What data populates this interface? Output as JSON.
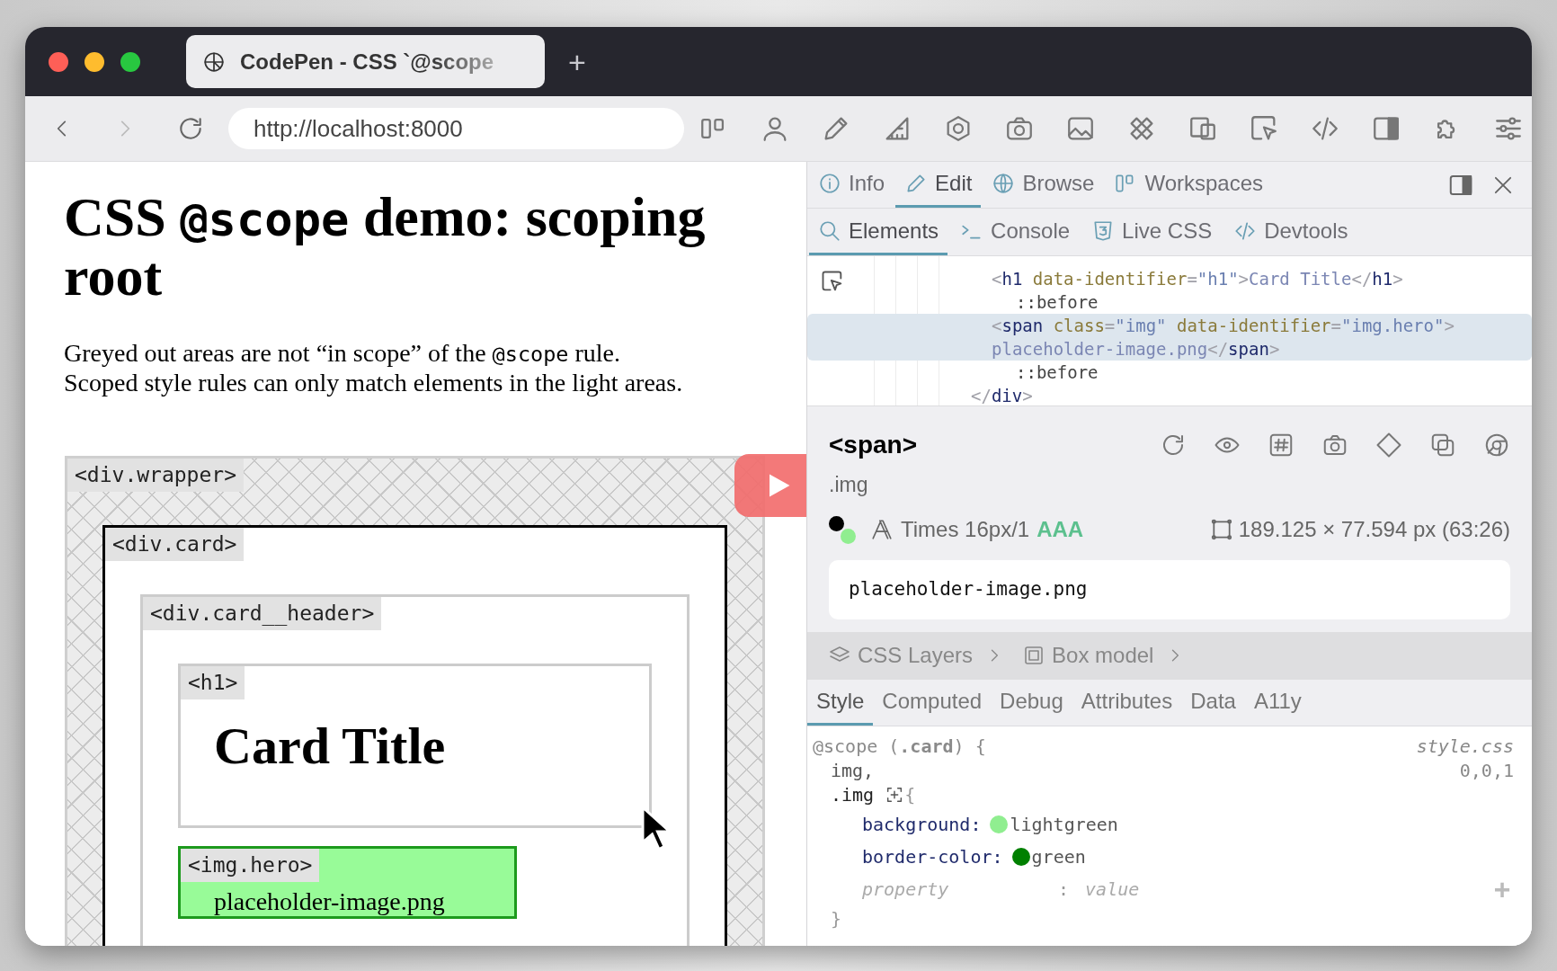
{
  "browser": {
    "tab": {
      "title": "CodePen - CSS `@scope"
    },
    "new_tab": "+",
    "url": "http://localhost:8000"
  },
  "page": {
    "heading": [
      {
        "text": "CSS ",
        "kind": "plain"
      },
      {
        "text": "@scope",
        "kind": "code"
      },
      {
        "text": " demo: scoping root",
        "kind": "plain"
      }
    ],
    "intro": [
      {
        "text": "Greyed out areas are not “in scope” of the ",
        "kind": "plain"
      },
      {
        "text": "@scope",
        "kind": "code"
      },
      {
        "text": " rule. Scoped style rules can only match elements in the light areas.",
        "kind": "plain"
      }
    ],
    "diagram": {
      "label": "<div.wrapper>",
      "kind": "out_of_scope",
      "children": [
        {
          "label": "<div.card>",
          "kind": "scope_root",
          "children": [
            {
              "label": "<div.card__header>",
              "kind": "element",
              "children": [
                {
                  "label": "<h1>",
                  "kind": "element",
                  "content": "Card Title"
                },
                {
                  "label": "<img.hero>",
                  "kind": "matched",
                  "content": "placeholder-image.png"
                }
              ]
            }
          ]
        }
      ]
    }
  },
  "devtools": {
    "top_tabs": [
      {
        "label": "Info",
        "selected": false
      },
      {
        "label": "Edit",
        "selected": true
      },
      {
        "label": "Browse",
        "selected": false
      },
      {
        "label": "Workspaces",
        "selected": false
      }
    ],
    "sub_tabs": [
      {
        "label": "Elements",
        "selected": true
      },
      {
        "label": "Console",
        "selected": false
      },
      {
        "label": "Live CSS",
        "selected": false
      },
      {
        "label": "Devtools",
        "selected": false
      }
    ],
    "dom_tree": {
      "children": [
        {
          "selected": false,
          "tokens": [
            {
              "text": "<",
              "kind": "punct"
            },
            {
              "text": "h1",
              "kind": "tag"
            },
            {
              "text": " data-identifier",
              "kind": "attr"
            },
            {
              "text": "=",
              "kind": "punct"
            },
            {
              "text": "\"h1\"",
              "kind": "value"
            },
            {
              "text": ">",
              "kind": "punct"
            },
            {
              "text": "Card Title",
              "kind": "text"
            },
            {
              "text": "</",
              "kind": "punct"
            },
            {
              "text": "h1",
              "kind": "tag"
            },
            {
              "text": ">",
              "kind": "punct"
            }
          ],
          "children": [
            {
              "selected": false,
              "tokens": [
                {
                  "text": "::before",
                  "kind": "pseudo"
                }
              ]
            }
          ]
        },
        {
          "selected": true,
          "tokens": [
            {
              "text": "<",
              "kind": "punct"
            },
            {
              "text": "span",
              "kind": "tag"
            },
            {
              "text": " class",
              "kind": "attr"
            },
            {
              "text": "=",
              "kind": "punct"
            },
            {
              "text": "\"img\"",
              "kind": "value"
            },
            {
              "text": " data-identifier",
              "kind": "attr"
            },
            {
              "text": "=",
              "kind": "punct"
            },
            {
              "text": "\"img.hero\"",
              "kind": "value"
            },
            {
              "text": ">",
              "kind": "punct"
            },
            {
              "text": "placeholder-image.png",
              "kind": "text"
            },
            {
              "text": "</",
              "kind": "punct"
            },
            {
              "text": "span",
              "kind": "tag"
            },
            {
              "text": ">",
              "kind": "punct"
            }
          ],
          "children": [
            {
              "selected": false,
              "tokens": [
                {
                  "text": "::before",
                  "kind": "pseudo"
                }
              ]
            }
          ]
        }
      ],
      "closing": [
        {
          "text": "</",
          "kind": "punct"
        },
        {
          "text": "div",
          "kind": "tag"
        },
        {
          "text": ">",
          "kind": "punct"
        }
      ]
    },
    "inspector": {
      "tag": "<span>",
      "class_name": ".img",
      "swatches": [
        {
          "color": "#000000"
        },
        {
          "color": "#90ee90"
        }
      ],
      "font": "Times 16px/1",
      "contrast": "AAA",
      "dimensions": "189.125 × 77.594 px (63:26)",
      "content": "placeholder-image.png"
    },
    "breadcrumbs": [
      "CSS Layers",
      "Box model"
    ],
    "style_tabs": [
      {
        "label": "Style",
        "selected": true
      },
      {
        "label": "Computed",
        "selected": false
      },
      {
        "label": "Debug",
        "selected": false
      },
      {
        "label": "Attributes",
        "selected": false
      },
      {
        "label": "Data",
        "selected": false
      },
      {
        "label": "A11y",
        "selected": false
      }
    ],
    "rule": {
      "at_rule": "@scope (**.card**) {",
      "source": "style.css",
      "specificity": "0,0,1",
      "selectors": [
        "img,",
        ".img"
      ],
      "open_brace": "{",
      "declarations": [
        {
          "property": "background:",
          "value": "lightgreen",
          "color": "#90ee90"
        },
        {
          "property": "border-color:",
          "value": "green",
          "color": "#008000"
        }
      ],
      "new_declaration": {
        "property_placeholder": "property",
        "separator": ":",
        "value_placeholder": "value",
        "add": "+"
      },
      "close_brace": "}"
    }
  }
}
